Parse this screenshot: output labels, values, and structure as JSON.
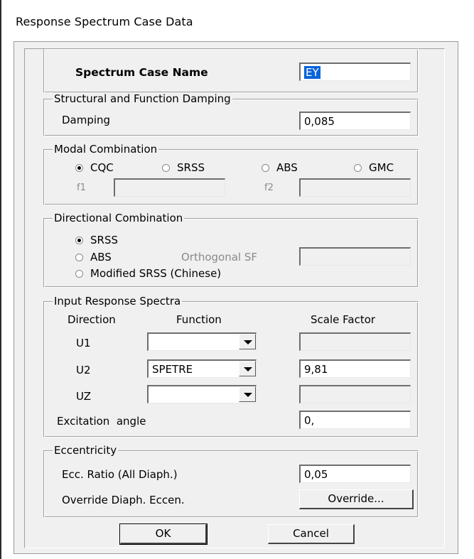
{
  "window": {
    "title": "Response Spectrum Case Data"
  },
  "spectrum_case": {
    "label": "Spectrum Case Name",
    "value": "EY"
  },
  "damping": {
    "group_title": "Structural and Function Damping",
    "label": "Damping",
    "value": "0,085"
  },
  "modal_combination": {
    "group_title": "Modal Combination",
    "options": [
      "CQC",
      "SRSS",
      "ABS",
      "GMC"
    ],
    "selected": "CQC",
    "f1_label": "f1",
    "f1_value": "",
    "f2_label": "f2",
    "f2_value": ""
  },
  "directional_combination": {
    "group_title": "Directional Combination",
    "options": [
      "SRSS",
      "ABS",
      "Modified SRSS (Chinese)"
    ],
    "selected": "SRSS",
    "orthogonal_sf_label": "Orthogonal SF",
    "orthogonal_sf_value": ""
  },
  "input_spectra": {
    "group_title": "Input Response Spectra",
    "col_direction": "Direction",
    "col_function": "Function",
    "col_scale": "Scale Factor",
    "rows": [
      {
        "direction": "U1",
        "function": "",
        "scale": ""
      },
      {
        "direction": "U2",
        "function": "SPETRE",
        "scale": "9,81"
      },
      {
        "direction": "UZ",
        "function": "",
        "scale": ""
      }
    ],
    "excitation_label": "Excitation  angle",
    "excitation_value": "0,"
  },
  "eccentricity": {
    "group_title": "Eccentricity",
    "ratio_label": "Ecc. Ratio (All Diaph.)",
    "ratio_value": "0,05",
    "override_label": "Override Diaph. Eccen.",
    "override_button": "Override..."
  },
  "buttons": {
    "ok": "OK",
    "cancel": "Cancel"
  }
}
